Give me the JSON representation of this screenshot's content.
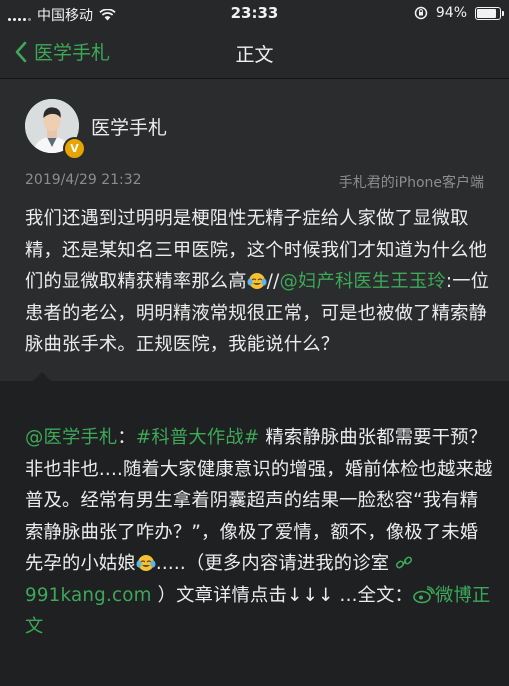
{
  "status": {
    "carrier": "中国移动",
    "time": "23:33",
    "battery_percent": "94%",
    "battery_level": 0.94
  },
  "nav": {
    "back_label": "医学手札",
    "title": "正文"
  },
  "post": {
    "author": "医学手札",
    "verified_badge": "V",
    "date": "2019/4/29 21:32",
    "source": "手札君的iPhone客户端",
    "text_part1": "我们还遇到过明明是梗阻性无精子症给人家做了显微取精，还是某知名三甲医院，这个时候我们才知道为什么他们的显微取精获精率那么高",
    "separator": "//",
    "mention": "@妇产科医生王玉玲",
    "text_part2": ":一位患者的老公，明明精液常规很正常，可是也被做了精索静脉曲张手术。正规医院，我能说什么？"
  },
  "original": {
    "mention": "@医学手札",
    "colon": "：",
    "topic": "#科普大作战#",
    "text1": " 精索静脉曲张都需要干预？非也非也....随着大家健康意识的增强，婚前体检也越来越普及。经常有男生拿着阴囊超声的结果一脸愁容“我有精索静脉曲张了咋办？”，像极了爱情，额不，像极了未婚先孕的小姑娘",
    "text2": ".....（更多内容请进我的诊室 ",
    "link_text": "991kang.com",
    "text3": " ）文章详情点击↓↓↓ ...全文：",
    "weibo_link": "微博正文"
  },
  "colors": {
    "accent": "#3ea858",
    "background": "#1e2021",
    "card": "#2a2c2d"
  }
}
